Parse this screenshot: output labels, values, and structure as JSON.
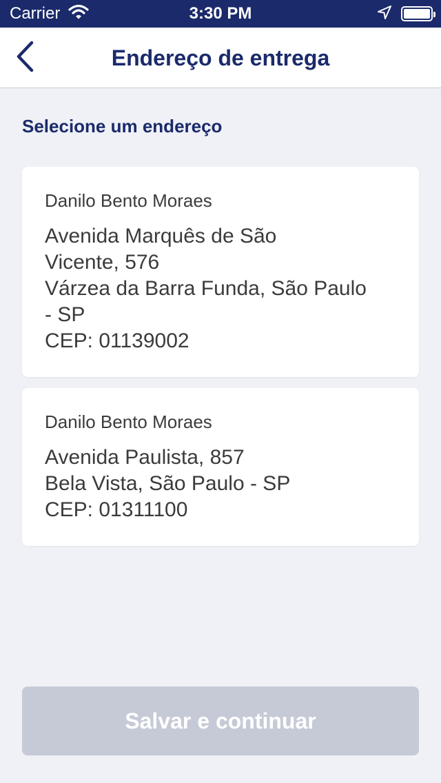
{
  "status_bar": {
    "carrier": "Carrier",
    "time": "3:30 PM",
    "icons": [
      "wifi-icon",
      "location-arrow-icon",
      "battery-icon"
    ]
  },
  "header": {
    "title": "Endereço de entrega",
    "back_icon": "chevron-left-icon"
  },
  "main": {
    "section_title": "Selecione um endereço",
    "addresses": [
      {
        "name": "Danilo Bento Moraes",
        "lines": [
          "Avenida Marquês de São",
          "Vicente, 576",
          "Várzea da Barra Funda, São Paulo",
          "- SP",
          "CEP: 01139002"
        ]
      },
      {
        "name": "Danilo Bento Moraes",
        "lines": [
          "Avenida Paulista, 857",
          "Bela Vista, São Paulo - SP",
          "CEP: 01311100"
        ]
      }
    ]
  },
  "footer": {
    "save_label": "Salvar e continuar"
  },
  "colors": {
    "brand": "#1b2a6b",
    "background": "#eff1f6",
    "card": "#ffffff",
    "text": "#3b3b3d",
    "button_disabled": "#c5cad6"
  }
}
